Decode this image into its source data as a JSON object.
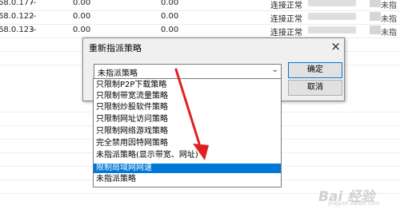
{
  "table": {
    "rows": [
      {
        "ip": "68.0.177",
        "dash": "--",
        "a": "0.00",
        "b": "0.00",
        "status": "连接正常",
        "last": "未指"
      },
      {
        "ip": "68.0.122",
        "dash": "--",
        "a": "0.00",
        "b": "0.00",
        "status": "连接正常",
        "last": "未指"
      },
      {
        "ip": "68.0.123",
        "dash": "--",
        "a": "0.00",
        "b": "0.00",
        "status": "连接正常",
        "last": "未指"
      }
    ]
  },
  "dialog": {
    "title": "重新指派策略",
    "close_glyph": "×",
    "combo_value": "未指派策略",
    "combo_arrow": "⌄",
    "ok_label": "确定",
    "cancel_label": "取消"
  },
  "dropdown": {
    "items": [
      "只限制P2P下载策略",
      "只限制带宽流量策略",
      "只限制炒股软件策略",
      "只限制网址访问策略",
      "只限制网络游戏策略",
      "完全禁用因特网策略",
      "未指派策略(显示带宽、网址)",
      "限制局域网网速",
      "未指派策略"
    ],
    "selected_index": 7
  },
  "annotation": {
    "color": "#e02020"
  },
  "watermark": {
    "text": "Bai 经验",
    "sub": "jingyan.baidu.com"
  }
}
